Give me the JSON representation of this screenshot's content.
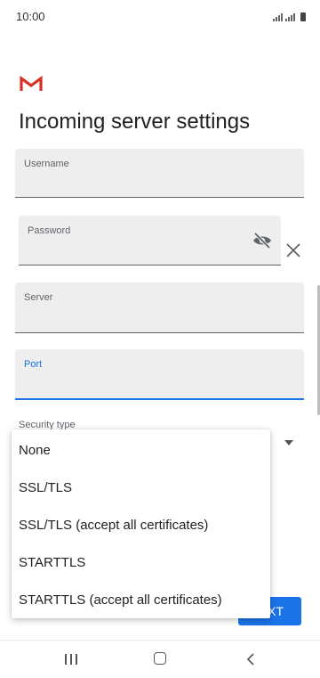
{
  "status": {
    "time": "10:00"
  },
  "page": {
    "title": "Incoming server settings"
  },
  "fields": {
    "username": {
      "label": "Username",
      "value": ""
    },
    "password": {
      "label": "Password",
      "value": ""
    },
    "server": {
      "label": "Server",
      "value": ""
    },
    "port": {
      "label": "Port",
      "value": ""
    }
  },
  "security": {
    "label": "Security type",
    "options": [
      "None",
      "SSL/TLS",
      "SSL/TLS (accept all certificates)",
      "STARTTLS",
      "STARTTLS (accept all certificates)"
    ]
  },
  "buttons": {
    "next_label": "XT"
  },
  "icons": {
    "logo": "gmail-logo",
    "password_toggle": "eye-off-icon",
    "clear": "close-icon",
    "dropdown": "dropdown-arrow-icon"
  },
  "colors": {
    "accent": "#1a73e8",
    "field_bg": "#eeeeee",
    "logo_red": "#d93025"
  }
}
